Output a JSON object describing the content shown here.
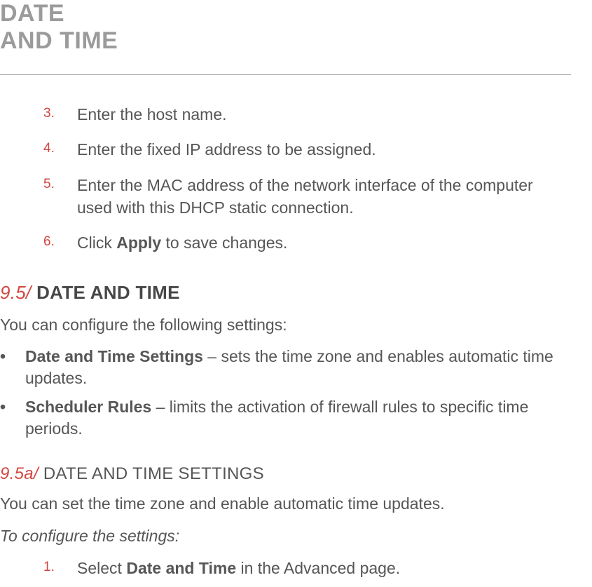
{
  "header": {
    "title_line1": "DATE",
    "title_line2": "AND TIME"
  },
  "steps_top": [
    {
      "marker": "3.",
      "text": "Enter the host name."
    },
    {
      "marker": "4.",
      "text": "Enter the fixed IP address to be assigned."
    },
    {
      "marker": "5.",
      "text": "Enter the MAC address of the network interface of the computer used with this DHCP static connection."
    },
    {
      "marker": "6.",
      "prefix": "Click ",
      "bold": "Apply",
      "suffix": " to save changes."
    }
  ],
  "section_95": {
    "num": "9.5/",
    "title": " DATE AND TIME",
    "intro": "You can configure the following settings:",
    "bullets": [
      {
        "bold": "Date and Time Settings",
        "text": " – sets the time zone and enables automatic time updates."
      },
      {
        "bold": "Scheduler Rules",
        "text": " – limits the activation of firewall rules to specific time periods."
      }
    ]
  },
  "section_95a": {
    "num": "9.5a/",
    "title": " DATE AND TIME SETTINGS",
    "intro": "You can set the time zone and enable automatic time updates.",
    "lead_italic": "To configure the settings:",
    "steps": [
      {
        "marker": "1.",
        "prefix": "Select ",
        "bold": "Date and Time",
        "suffix": " in the Advanced page."
      }
    ]
  }
}
